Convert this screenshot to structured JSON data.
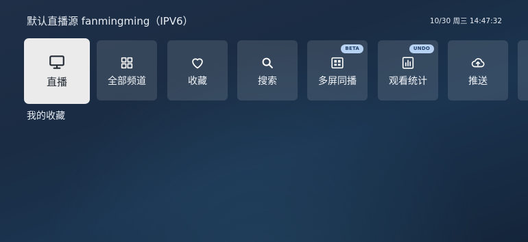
{
  "header": {
    "title": "默认直播源 fanmingming（IPV6）",
    "clock": "10/30 周三 14:47:32"
  },
  "menu": [
    {
      "id": "live",
      "label": "直播",
      "icon": "tv-icon",
      "selected": true
    },
    {
      "id": "all-channels",
      "label": "全部频道",
      "icon": "grid-icon"
    },
    {
      "id": "favorites",
      "label": "收藏",
      "icon": "heart-icon"
    },
    {
      "id": "search",
      "label": "搜索",
      "icon": "search-icon"
    },
    {
      "id": "multiscreen",
      "label": "多屏同播",
      "icon": "multiscreen-icon",
      "badge": "BETA"
    },
    {
      "id": "stats",
      "label": "观看统计",
      "icon": "stats-icon",
      "badge": "UNDO"
    },
    {
      "id": "push",
      "label": "推送",
      "icon": "cloud-upload-icon"
    }
  ],
  "section": {
    "title": "我的收藏"
  },
  "colors": {
    "active_tile": "#ebebeb",
    "tile": "rgba(255,255,255,0.12)",
    "badge_bg": "#b7d2f2",
    "badge_text": "#1f3e66"
  }
}
